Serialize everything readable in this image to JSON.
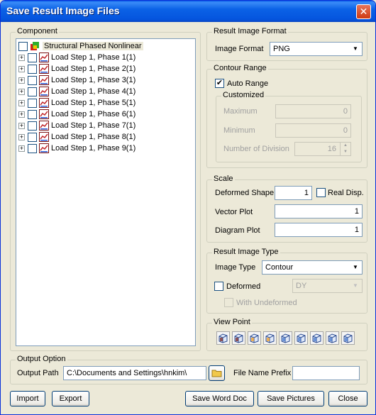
{
  "window": {
    "title": "Save Result Image Files",
    "close_glyph": "✕"
  },
  "component": {
    "group_label": "Component",
    "root": "Structural Phased Nonlinear",
    "items": [
      "Load Step 1, Phase  1(1)",
      "Load Step 1, Phase  2(1)",
      "Load Step 1, Phase  3(1)",
      "Load Step 1, Phase  4(1)",
      "Load Step 1, Phase  5(1)",
      "Load Step 1, Phase  6(1)",
      "Load Step 1, Phase  7(1)",
      "Load Step 1, Phase  8(1)",
      "Load Step 1, Phase  9(1)"
    ]
  },
  "result_image_format": {
    "group_label": "Result Image Format",
    "image_format_label": "Image Format",
    "image_format_value": "PNG"
  },
  "contour_range": {
    "group_label": "Contour Range",
    "auto_range_label": "Auto Range",
    "auto_range_checked": true,
    "customized_label": "Customized",
    "maximum_label": "Maximum",
    "maximum_value": "0",
    "minimum_label": "Minimum",
    "minimum_value": "0",
    "divisions_label": "Number of Division",
    "divisions_value": "16"
  },
  "scale": {
    "group_label": "Scale",
    "deformed_shape_label": "Deformed Shape",
    "deformed_shape_value": "1",
    "real_disp_label": "Real Disp.",
    "vector_plot_label": "Vector Plot",
    "vector_plot_value": "1",
    "diagram_plot_label": "Diagram Plot",
    "diagram_plot_value": "1"
  },
  "result_image_type": {
    "group_label": "Result Image Type",
    "image_type_label": "Image Type",
    "image_type_value": "Contour",
    "deformed_label": "Deformed",
    "deformed_select_value": "DY",
    "with_undeformed_label": "With Undeformed"
  },
  "view_point": {
    "group_label": "View Point",
    "buttons": [
      "view-x-icon",
      "view-y-icon",
      "view-z-icon",
      "view-iso1-icon",
      "view-iso2-icon",
      "view-iso3-icon",
      "view-iso4-icon",
      "view-iso5-icon",
      "view-iso6-icon"
    ]
  },
  "output_option": {
    "group_label": "Output Option",
    "output_path_label": "Output Path",
    "output_path_value": "C:\\Documents and Settings\\hnkim\\",
    "file_name_prefix_label": "File Name Prefix",
    "file_name_prefix_value": ""
  },
  "footer": {
    "import_label": "Import",
    "export_label": "Export",
    "save_word_doc_label": "Save Word Doc",
    "save_pictures_label": "Save Pictures",
    "close_label": "Close"
  },
  "colors": {
    "title_bar": "#0b62e6",
    "dialog_bg": "#ece9d8",
    "border": "#7f9db9"
  }
}
